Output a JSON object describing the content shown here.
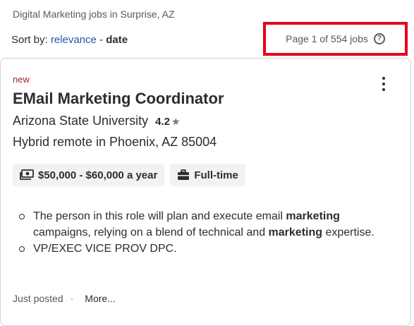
{
  "search": {
    "title": "Digital Marketing jobs in Surprise, AZ"
  },
  "sort": {
    "label": "Sort by:",
    "relevance": "relevance",
    "separator": "-",
    "date": "date"
  },
  "pagination": {
    "text": "Page 1 of 554 jobs",
    "help_icon": "question-circle-icon"
  },
  "job": {
    "badge": "new",
    "title": "EMail Marketing Coordinator",
    "company": "Arizona State University",
    "rating": "4.2",
    "rating_icon": "star-icon",
    "location": "Hybrid remote in Phoenix, AZ 85004",
    "salary": "$50,000 - $60,000 a year",
    "salary_icon": "money-icon",
    "job_type": "Full-time",
    "job_type_icon": "briefcase-icon",
    "snippet": {
      "bullet1": {
        "part1": "The person in this role will plan and execute email ",
        "bold1": "marketing",
        "part2": " campaigns, relying on a blend of technical and ",
        "bold2": "marketing",
        "part3": " expertise."
      },
      "bullet2": "VP/EXEC VICE PROV DPC."
    },
    "posted": "Just posted",
    "footer_dot": "·",
    "more": "More..."
  },
  "colors": {
    "highlight_border": "#e4001e",
    "link": "#2557a7",
    "new_badge": "#a9252b"
  }
}
